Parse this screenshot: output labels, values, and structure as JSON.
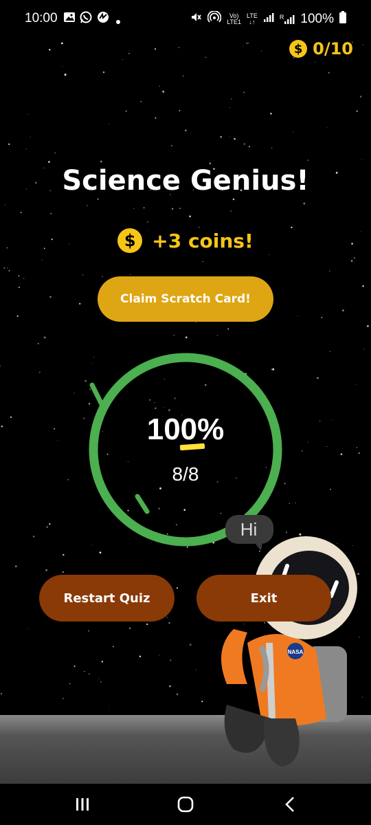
{
  "status_bar": {
    "time": "10:00",
    "battery": "100%",
    "volte_label": "Vo)",
    "lte1_label": "LTE1",
    "lte_label": "LTE",
    "signal_label": "R"
  },
  "coin_counter": {
    "icon": "dollar-coin-icon",
    "value": "0/10"
  },
  "title": "Science Genius!",
  "reward": {
    "icon": "dollar-coin-icon",
    "text": "+3 coins!"
  },
  "claim_button": {
    "label": "Claim Scratch Card!"
  },
  "score": {
    "percent_text": "100%",
    "fraction_text": "8/8",
    "progress_fraction": 1.0
  },
  "astronaut": {
    "speech_bubble": "Hi",
    "badge": "NASA"
  },
  "buttons": {
    "restart_label": "Restart Quiz",
    "exit_label": "Exit"
  },
  "nav": {
    "recents_icon": "recents-icon",
    "home_icon": "home-icon",
    "back_icon": "back-icon"
  },
  "colors": {
    "accent_gold": "#f5c518",
    "claim_button": "#dfa614",
    "ring_green": "#4caf50",
    "action_brown": "#8a3a06"
  }
}
